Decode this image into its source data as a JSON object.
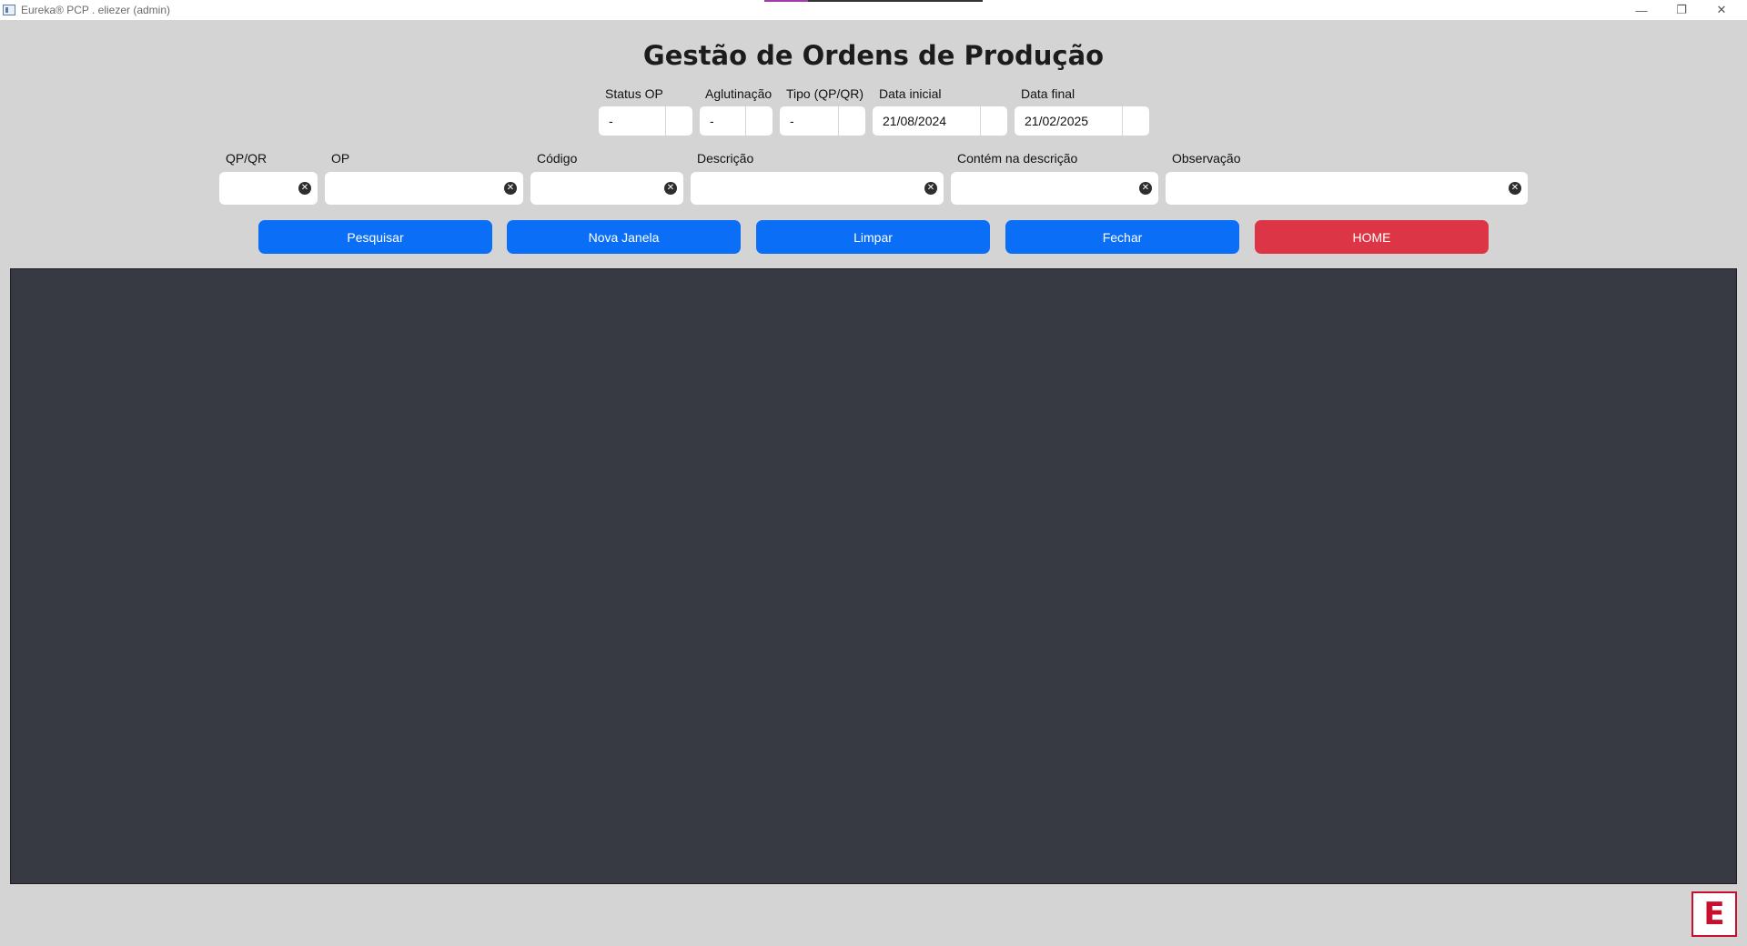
{
  "window": {
    "title": "Eureka® PCP . eliezer (admin)",
    "minimize_glyph": "—",
    "restore_glyph": "❐",
    "close_glyph": "✕"
  },
  "page": {
    "title": "Gestão de Ordens de Produção"
  },
  "filters_row1": {
    "status_op": {
      "label": "Status OP",
      "value": "-"
    },
    "aglutinacao": {
      "label": "Aglutinação",
      "value": "-"
    },
    "tipo": {
      "label": "Tipo (QP/QR)",
      "value": "-"
    },
    "data_inicial": {
      "label": "Data inicial",
      "value": "21/08/2024"
    },
    "data_final": {
      "label": "Data final",
      "value": "21/02/2025"
    }
  },
  "filters_row2": {
    "qp_qr": {
      "label": "QP/QR",
      "value": ""
    },
    "op": {
      "label": "OP",
      "value": ""
    },
    "codigo": {
      "label": "Código",
      "value": ""
    },
    "descricao": {
      "label": "Descrição",
      "value": ""
    },
    "contem_descricao": {
      "label": "Contém na descrição",
      "value": ""
    },
    "observacao": {
      "label": "Observação",
      "value": ""
    }
  },
  "buttons": {
    "pesquisar": "Pesquisar",
    "nova_janela": "Nova Janela",
    "limpar": "Limpar",
    "fechar": "Fechar",
    "home": "HOME"
  },
  "logo": {
    "letter": "E"
  },
  "colors": {
    "background": "#d4d4d4",
    "primary_button": "#0b6ef7",
    "home_button": "#dc3545",
    "results_panel": "#383a43",
    "logo_red": "#c8102e"
  }
}
